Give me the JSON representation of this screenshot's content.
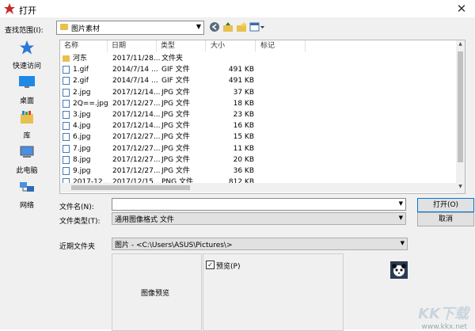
{
  "window": {
    "title": "打开",
    "close": "✕"
  },
  "lookin": {
    "label": "查找范围(I):",
    "value": "图片素材"
  },
  "places": [
    {
      "name": "quick-access",
      "label": "快速访问"
    },
    {
      "name": "desktop",
      "label": "桌面"
    },
    {
      "name": "library",
      "label": "库"
    },
    {
      "name": "this-pc",
      "label": "此电脑"
    },
    {
      "name": "network",
      "label": "网络"
    }
  ],
  "columns": {
    "name": "名称",
    "date": "日期",
    "type": "类型",
    "size": "大小",
    "tag": "标记"
  },
  "files": [
    {
      "name": "河东",
      "date": "2017/11/28...",
      "type": "文件夹",
      "size": "",
      "kind": "folder"
    },
    {
      "name": "1.gif",
      "date": "2014/7/14 ...",
      "type": "GIF 文件",
      "size": "491 KB",
      "kind": "image"
    },
    {
      "name": "2.gif",
      "date": "2014/7/14 ...",
      "type": "GIF 文件",
      "size": "491 KB",
      "kind": "image"
    },
    {
      "name": "2.jpg",
      "date": "2017/12/14...",
      "type": "JPG 文件",
      "size": "37 KB",
      "kind": "image"
    },
    {
      "name": "2Q==.jpg",
      "date": "2017/12/27...",
      "type": "JPG 文件",
      "size": "18 KB",
      "kind": "image"
    },
    {
      "name": "3.jpg",
      "date": "2017/12/14...",
      "type": "JPG 文件",
      "size": "23 KB",
      "kind": "image"
    },
    {
      "name": "4.jpg",
      "date": "2017/12/14...",
      "type": "JPG 文件",
      "size": "16 KB",
      "kind": "image"
    },
    {
      "name": "6.jpg",
      "date": "2017/12/27...",
      "type": "JPG 文件",
      "size": "15 KB",
      "kind": "image"
    },
    {
      "name": "7.jpg",
      "date": "2017/12/27...",
      "type": "JPG 文件",
      "size": "11 KB",
      "kind": "image"
    },
    {
      "name": "8.jpg",
      "date": "2017/12/27...",
      "type": "JPG 文件",
      "size": "20 KB",
      "kind": "image"
    },
    {
      "name": "9.jpg",
      "date": "2017/12/27...",
      "type": "JPG 文件",
      "size": "36 KB",
      "kind": "image"
    },
    {
      "name": "2017-12...",
      "date": "2017/12/15...",
      "type": "PNG 文件",
      "size": "812 KB",
      "kind": "image"
    }
  ],
  "filename": {
    "label": "文件名(N):",
    "value": ""
  },
  "filetype": {
    "label": "文件类型(T):",
    "value": "通用图像格式 文件"
  },
  "buttons": {
    "open": "打开(O)",
    "cancel": "取消"
  },
  "recent": {
    "label": "近期文件夹",
    "value": "图片 - <C:\\Users\\ASUS\\Pictures\\>"
  },
  "preview": {
    "area_label": "图像预览",
    "checkbox_label": "预览(P)",
    "checked": true
  },
  "watermark": {
    "logo": "KK下载",
    "url": "www.kkx.net"
  },
  "colors": {
    "accent": "#0078d7",
    "folder": "#e8c04e",
    "titleIcon": "#c62828"
  }
}
